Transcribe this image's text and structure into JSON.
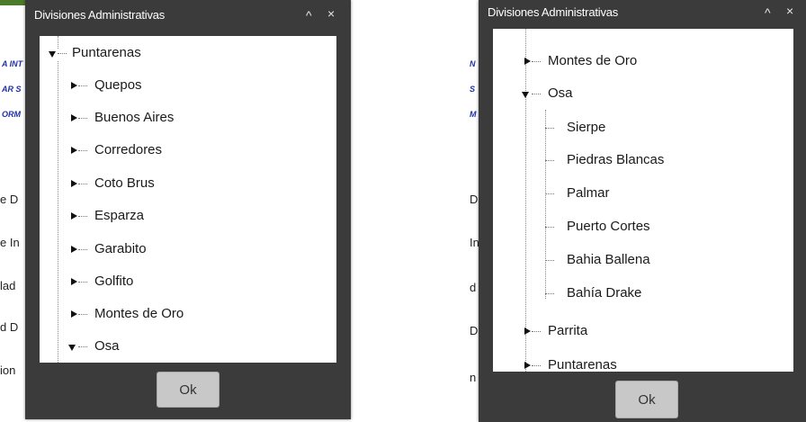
{
  "left": {
    "background": {
      "side_links": [
        "A INT",
        "AR S",
        "ORM"
      ],
      "side_texts": [
        "e D",
        "e In",
        "lad",
        "d D",
        "ion"
      ]
    },
    "dialog": {
      "title": "Divisiones Administrativas",
      "collapse_glyph": "^",
      "close_glyph": "×",
      "ok_label": "Ok",
      "tree": {
        "root": {
          "label": "Puntarenas",
          "state": "expanded"
        },
        "children": [
          {
            "label": "Quepos",
            "state": "collapsed"
          },
          {
            "label": "Buenos Aires",
            "state": "collapsed"
          },
          {
            "label": "Corredores",
            "state": "collapsed"
          },
          {
            "label": "Coto Brus",
            "state": "collapsed"
          },
          {
            "label": "Esparza",
            "state": "collapsed"
          },
          {
            "label": "Garabito",
            "state": "collapsed"
          },
          {
            "label": "Golfito",
            "state": "collapsed"
          },
          {
            "label": "Montes de Oro",
            "state": "collapsed"
          },
          {
            "label": "Osa",
            "state": "expanded"
          }
        ]
      }
    }
  },
  "right": {
    "background": {
      "side_links": [
        "N",
        "S",
        "M"
      ],
      "side_texts": [
        "D",
        "In",
        "d",
        "D",
        "n"
      ]
    },
    "dialog": {
      "title": "Divisiones Administrativas",
      "collapse_glyph": "^",
      "close_glyph": "×",
      "ok_label": "Ok",
      "tree": {
        "items": [
          {
            "label": "Montes de Oro",
            "state": "collapsed"
          },
          {
            "label": "Osa",
            "state": "expanded"
          },
          {
            "label": "Parrita",
            "state": "collapsed"
          },
          {
            "label": "Puntarenas",
            "state": "collapsed"
          }
        ],
        "osa_children": [
          "Sierpe",
          "Piedras Blancas",
          "Palmar",
          "Puerto Cortes",
          "Bahia Ballena",
          "Bahía Drake"
        ]
      }
    }
  },
  "colors": {
    "dialog_bg": "#3b3b3b",
    "button_bg": "#c8c8c8",
    "link_blue": "#1f2fa8"
  }
}
